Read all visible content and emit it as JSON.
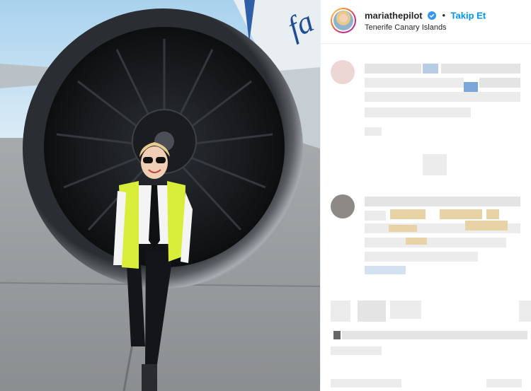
{
  "post": {
    "username": "mariathepilot",
    "follow_label": "Takip Et",
    "separator": "•",
    "location": "Tenerife Canary Islands",
    "verified_icon": "verified-badge-icon",
    "follow_color": "#0095f6"
  }
}
